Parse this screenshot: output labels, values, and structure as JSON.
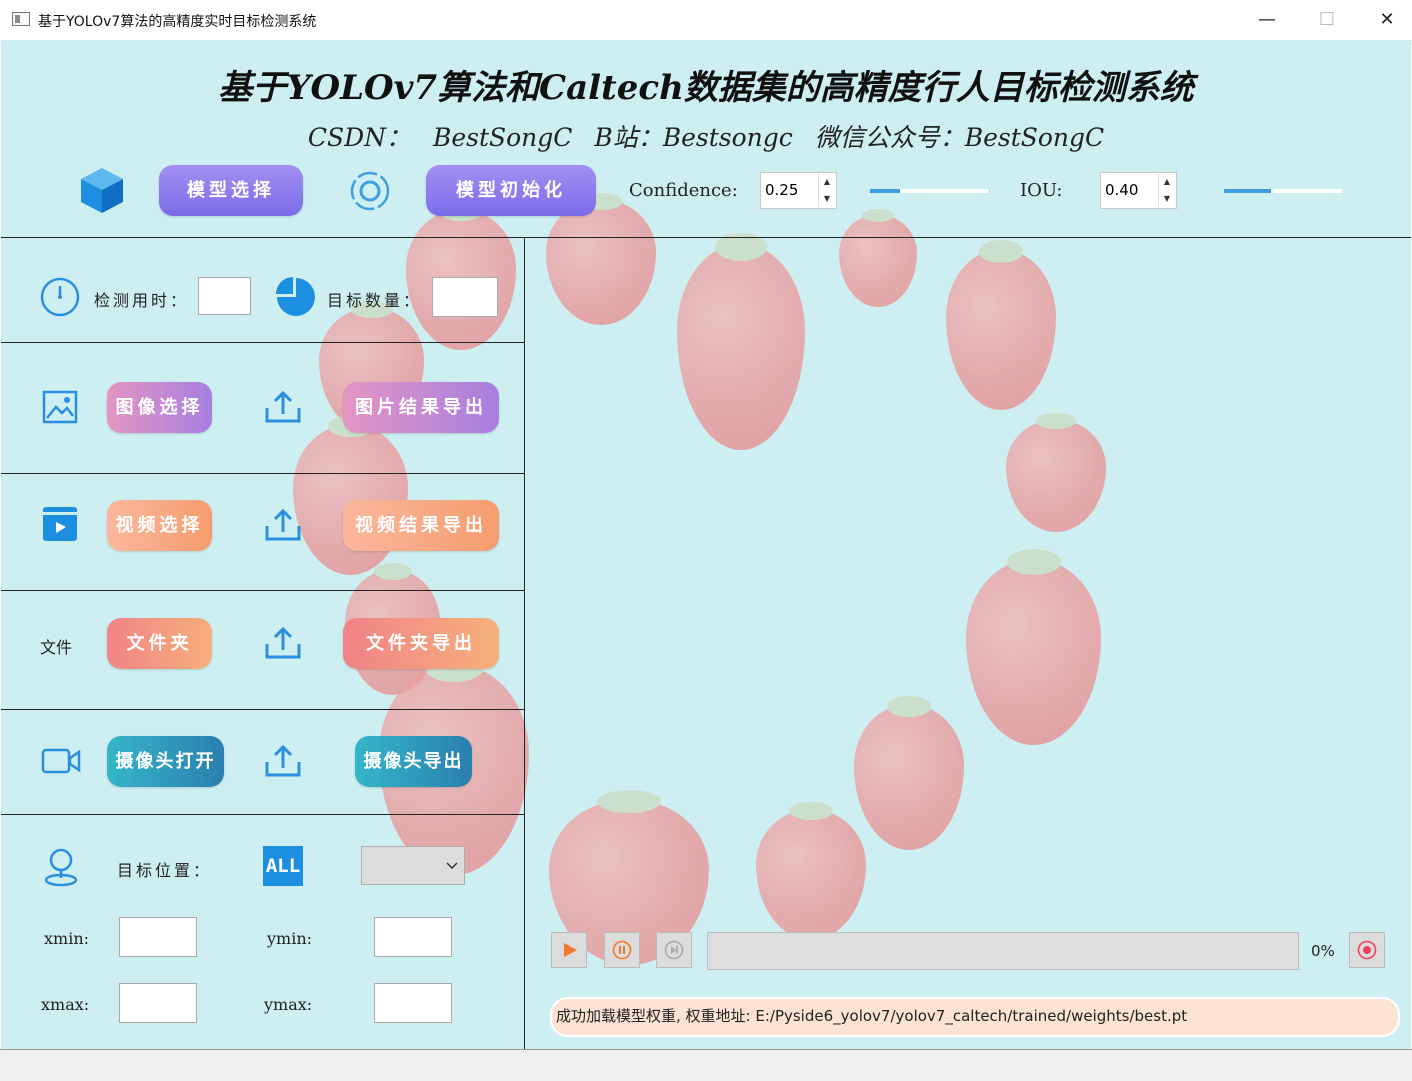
{
  "window": {
    "title": "基于YOLOv7算法的高精度实时目标检测系统",
    "minimize": "—",
    "maximize": "☐",
    "close": "✕"
  },
  "header": {
    "title": "基于YOLOv7算法和Caltech数据集的高精度行人目标检测系统",
    "subtitle": "CSDN： BestSongC B站：Bestsongc 微信公众号：BestSongC"
  },
  "toolbar": {
    "model_select": "模型选择",
    "model_init": "模型初始化",
    "confidence_label": "Confidence:",
    "confidence_value": "0.25",
    "confidence_level": 0.25,
    "iou_label": "IOU:",
    "iou_value": "0.40",
    "iou_level": 0.4
  },
  "stats": {
    "detect_time_label": "检测用时：",
    "target_count_label": "目标数量："
  },
  "image_row": {
    "select": "图像选择",
    "export": "图片结果导出"
  },
  "video_row": {
    "select": "视频选择",
    "export": "视频结果导出"
  },
  "folder_row": {
    "icon_text": "文件",
    "select": "文件夹",
    "export": "文件夹导出"
  },
  "camera_row": {
    "open": "摄像头打开",
    "export": "摄像头导出"
  },
  "position": {
    "label": "目标位置：",
    "all_badge": "ALL",
    "xmin": "xmin:",
    "ymin": "ymin:",
    "xmax": "xmax:",
    "ymax": "ymax:"
  },
  "player": {
    "percent": "0%",
    "progress": 0
  },
  "log": {
    "message": "成功加载模型权重, 权重地址: E:/Pyside6_yolov7/yolov7_caltech/trained/weights/best.pt"
  },
  "colors": {
    "background": "#cdeff1",
    "accent_blue": "#3e9ee0",
    "play_orange": "#f4792b"
  }
}
